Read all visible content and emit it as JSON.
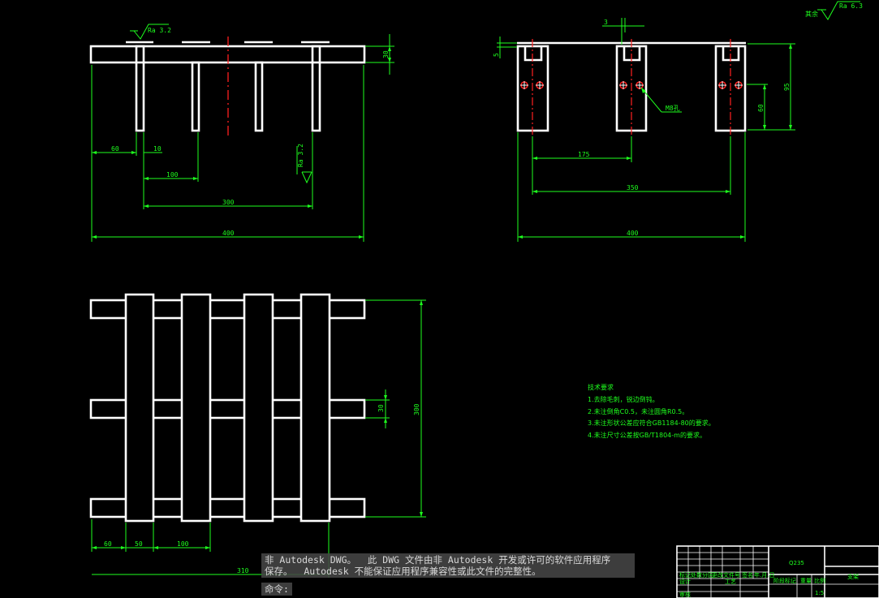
{
  "colors": {
    "background": "#000000",
    "outline": "#ffffff",
    "dimension": "#1eff1e",
    "centerline": "#ff2020"
  },
  "front_view": {
    "roughness": "Ra 3.2",
    "roughness_right": "Ra 3.2",
    "dims": {
      "height_right": "30",
      "offset_left": "60",
      "post_width": "10",
      "spacing": "100",
      "span_300": "300",
      "overall": "400"
    }
  },
  "side_view": {
    "dims": {
      "top_gap": "3",
      "left_small": "5",
      "height_total": "95",
      "height_lower": "60",
      "span_175": "175",
      "span_350": "350",
      "overall": "400"
    },
    "leader_label": "M8孔"
  },
  "top_view": {
    "dims": {
      "bar_width": "30",
      "overall_height": "300",
      "left_60": "60",
      "left_50": "50",
      "spacing_100": "100",
      "span_310": "310"
    }
  },
  "top_right": {
    "rest_label": "其余",
    "roughness": "Ra 6.3"
  },
  "tech_notes": {
    "title": "技术要求",
    "items": [
      "1.去除毛刺，锐边倒钝。",
      "2.未注倒角C0.5，未注圆角R0.5。",
      "3.未注形状公差应符合GB1184-80的要求。",
      "4.未注尺寸公差按GB/T1804-m的要求。"
    ]
  },
  "title_block": {
    "material": "Q235",
    "part_name": "支架",
    "scale_label": "比例",
    "scale_value": "1:5",
    "weight_label": "重量",
    "labels": [
      "标记",
      "处数",
      "分区",
      "更改文件号",
      "签名",
      "年.月.日"
    ],
    "row_labels": [
      "设计",
      "审核",
      "工艺"
    ],
    "stage_label": "阶段标记"
  },
  "command_line": {
    "message_line1": "非 Autodesk DWG。  此 DWG 文件由非 Autodesk 开发或许可的软件应用程序",
    "message_line2": "保存。  Autodesk 不能保证应用程序兼容性或此文件的完整性。",
    "prompt": "命令:"
  }
}
